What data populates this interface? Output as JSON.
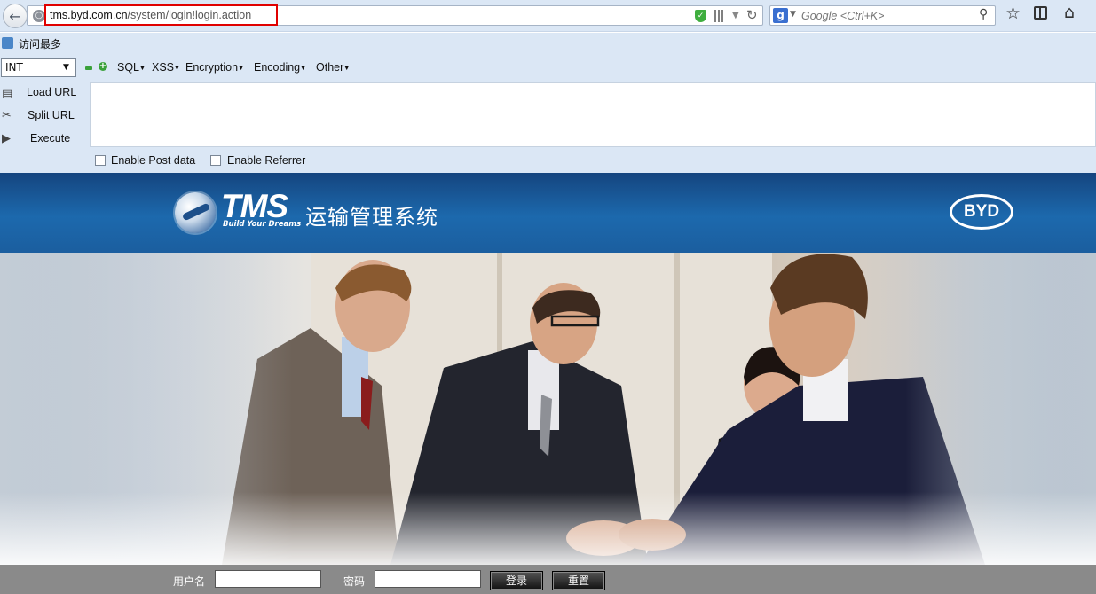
{
  "browser": {
    "url_host": "tms.byd.com.cn",
    "url_path": "/system/login!login.action",
    "search_placeholder": "Google <Ctrl+K>",
    "search_engine_glyph": "g",
    "icons": [
      "back-arrow-icon",
      "globe-icon",
      "shield-icon",
      "qr-code-icon",
      "dropmarker-icon",
      "reload-icon",
      "search-engine-icon",
      "search-go-icon",
      "bookmark-star-icon",
      "bookmarks-list-icon",
      "home-icon"
    ]
  },
  "bookmarks_toolbar": {
    "items": [
      {
        "label": "访问最多",
        "icon": "most-visited-icon"
      }
    ]
  },
  "hackbar": {
    "type_select": "INT",
    "menus": [
      "SQL",
      "XSS",
      "Encryption",
      "Encoding",
      "Other"
    ],
    "actions": [
      {
        "label": "Load URL",
        "icon": "load-url-icon"
      },
      {
        "label": "Split URL",
        "icon": "split-url-icon"
      },
      {
        "label": "Execute",
        "icon": "execute-icon"
      }
    ],
    "textarea_value": "",
    "checkboxes": [
      {
        "label": "Enable Post data",
        "checked": false
      },
      {
        "label": "Enable Referrer",
        "checked": false
      }
    ]
  },
  "page": {
    "logo_text": "TMS",
    "logo_tagline": "Build Your Dreams",
    "system_title": "运输管理系统",
    "brand_logo_text": "BYD",
    "login": {
      "username_label": "用户名",
      "username_value": "",
      "password_label": "密码",
      "password_value": "",
      "login_button": "登录",
      "reset_button": "重置"
    }
  },
  "colors": {
    "chrome_bg": "#dbe7f5",
    "banner_blue": "#1c69ad",
    "login_bar": "#8a8a8a",
    "url_highlight": "#e00000"
  }
}
